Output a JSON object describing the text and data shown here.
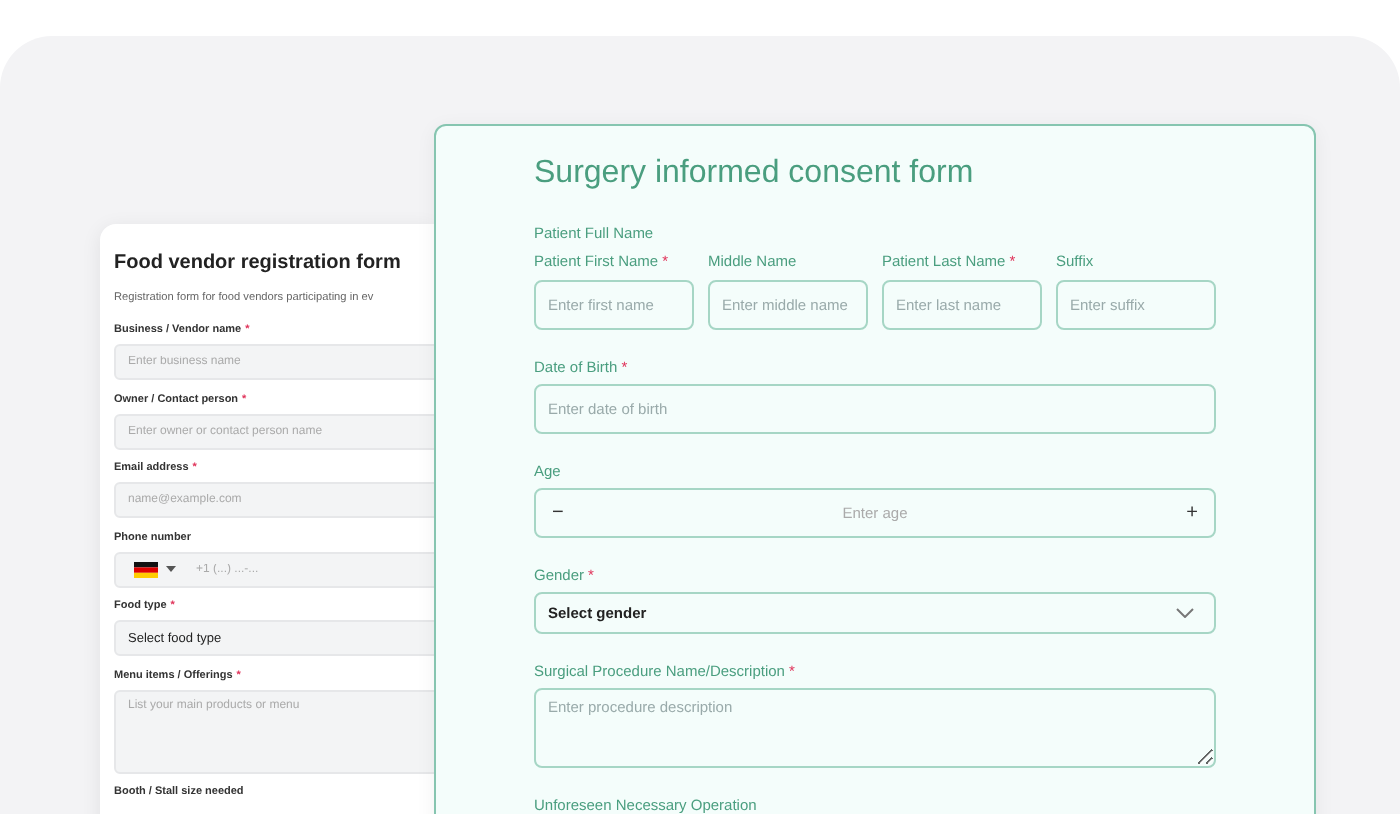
{
  "required_mark": "*",
  "background_form": {
    "title": "Food vendor registration form",
    "description": "Registration form for food vendors participating in ev",
    "fields": [
      {
        "kind": "text",
        "label": "Business / Vendor name",
        "required": true,
        "placeholder": "Enter business name"
      },
      {
        "kind": "text",
        "label": "Owner / Contact person",
        "required": true,
        "placeholder": "Enter owner or contact person name"
      },
      {
        "kind": "text",
        "label": "Email address",
        "required": true,
        "placeholder": "name@example.com"
      },
      {
        "kind": "phone",
        "label": "Phone number",
        "required": false,
        "placeholder": "+1 (...) ...-..."
      },
      {
        "kind": "select",
        "label": "Food type",
        "required": true,
        "value": "Select food type"
      },
      {
        "kind": "textarea",
        "label": "Menu items / Offerings",
        "required": true,
        "placeholder": "List your main products or menu"
      },
      {
        "kind": "label",
        "label": "Booth / Stall size needed",
        "required": false
      }
    ]
  },
  "main_form": {
    "title": "Surgery informed consent form",
    "name_group": {
      "label": "Patient Full Name",
      "fields": [
        {
          "label": "Patient First Name",
          "required": true,
          "placeholder": "Enter first name"
        },
        {
          "label": "Middle Name",
          "required": false,
          "placeholder": "Enter middle name"
        },
        {
          "label": "Patient Last Name",
          "required": true,
          "placeholder": "Enter last name"
        },
        {
          "label": "Suffix",
          "required": false,
          "placeholder": "Enter suffix"
        }
      ]
    },
    "fields": [
      {
        "kind": "text",
        "label": "Date of Birth",
        "required": true,
        "placeholder": "Enter date of birth"
      },
      {
        "kind": "stepper",
        "label": "Age",
        "required": false,
        "placeholder": "Enter age",
        "minus": "−",
        "plus": "+"
      },
      {
        "kind": "select",
        "label": "Gender",
        "required": true,
        "value": "Select gender"
      },
      {
        "kind": "textarea",
        "label": "Surgical Procedure Name/Description",
        "required": true,
        "placeholder": "Enter procedure description"
      },
      {
        "kind": "label",
        "label": "Unforeseen Necessary Operation",
        "required": false
      }
    ]
  }
}
